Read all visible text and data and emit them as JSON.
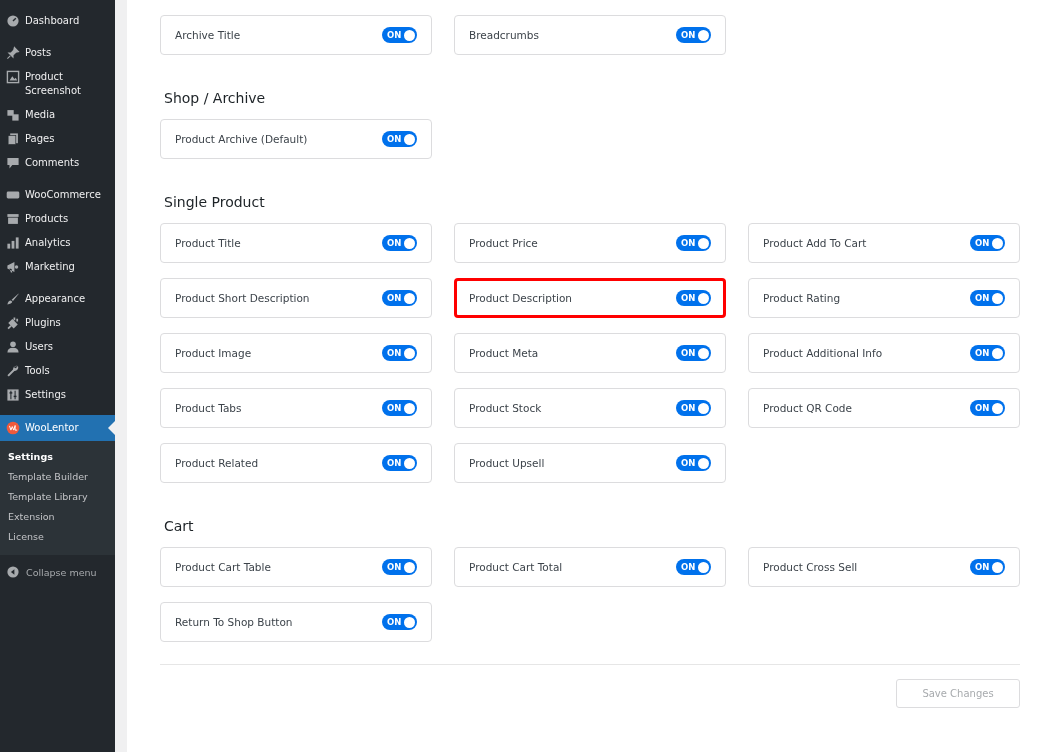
{
  "sidebar": {
    "groups": [
      [
        {
          "label": "Dashboard",
          "kind": "dashboard",
          "selected": false
        }
      ],
      [
        {
          "label": "Posts",
          "kind": "pin",
          "selected": false
        },
        {
          "label": "Product Screenshot",
          "kind": "image",
          "selected": false
        },
        {
          "label": "Media",
          "kind": "media",
          "selected": false
        },
        {
          "label": "Pages",
          "kind": "pages",
          "selected": false
        },
        {
          "label": "Comments",
          "kind": "comment",
          "selected": false
        }
      ],
      [
        {
          "label": "WooCommerce",
          "kind": "woo",
          "selected": false
        },
        {
          "label": "Products",
          "kind": "box",
          "selected": false
        },
        {
          "label": "Analytics",
          "kind": "bars",
          "selected": false
        },
        {
          "label": "Marketing",
          "kind": "megaphone",
          "selected": false
        }
      ],
      [
        {
          "label": "Appearance",
          "kind": "brush",
          "selected": false
        },
        {
          "label": "Plugins",
          "kind": "plug",
          "selected": false
        },
        {
          "label": "Users",
          "kind": "user",
          "selected": false
        },
        {
          "label": "Tools",
          "kind": "wrench",
          "selected": false
        },
        {
          "label": "Settings",
          "kind": "sliders",
          "selected": false
        }
      ],
      [
        {
          "label": "WooLentor",
          "kind": "wl",
          "selected": true
        }
      ]
    ],
    "submenu": [
      {
        "label": "Settings",
        "selected": true
      },
      {
        "label": "Template Builder",
        "selected": false
      },
      {
        "label": "Template Library",
        "selected": false
      },
      {
        "label": "Extension",
        "selected": false
      },
      {
        "label": "License",
        "selected": false
      }
    ],
    "collapse": "Collapse menu"
  },
  "sections": [
    {
      "items": [
        {
          "label": "Archive Title",
          "on": true,
          "toggle_text": "ON",
          "highlighted": false
        },
        {
          "label": "Breadcrumbs",
          "on": true,
          "toggle_text": "ON",
          "highlighted": false
        }
      ]
    },
    {
      "heading": "Shop / Archive",
      "items": [
        {
          "label": "Product Archive (Default)",
          "on": true,
          "toggle_text": "ON",
          "highlighted": false
        }
      ]
    },
    {
      "heading": "Single Product",
      "items": [
        {
          "label": "Product Title",
          "on": true,
          "toggle_text": "ON",
          "highlighted": false
        },
        {
          "label": "Product Price",
          "on": true,
          "toggle_text": "ON",
          "highlighted": false
        },
        {
          "label": "Product Add To Cart",
          "on": true,
          "toggle_text": "ON",
          "highlighted": false
        },
        {
          "label": "Product Short Description",
          "on": true,
          "toggle_text": "ON",
          "highlighted": false
        },
        {
          "label": "Product Description",
          "on": true,
          "toggle_text": "ON",
          "highlighted": true
        },
        {
          "label": "Product Rating",
          "on": true,
          "toggle_text": "ON",
          "highlighted": false
        },
        {
          "label": "Product Image",
          "on": true,
          "toggle_text": "ON",
          "highlighted": false
        },
        {
          "label": "Product Meta",
          "on": true,
          "toggle_text": "ON",
          "highlighted": false
        },
        {
          "label": "Product Additional Info",
          "on": true,
          "toggle_text": "ON",
          "highlighted": false
        },
        {
          "label": "Product Tabs",
          "on": true,
          "toggle_text": "ON",
          "highlighted": false
        },
        {
          "label": "Product Stock",
          "on": true,
          "toggle_text": "ON",
          "highlighted": false
        },
        {
          "label": "Product QR Code",
          "on": true,
          "toggle_text": "ON",
          "highlighted": false
        },
        {
          "label": "Product Related",
          "on": true,
          "toggle_text": "ON",
          "highlighted": false
        },
        {
          "label": "Product Upsell",
          "on": true,
          "toggle_text": "ON",
          "highlighted": false
        }
      ]
    },
    {
      "heading": "Cart",
      "items": [
        {
          "label": "Product Cart Table",
          "on": true,
          "toggle_text": "ON",
          "highlighted": false
        },
        {
          "label": "Product Cart Total",
          "on": true,
          "toggle_text": "ON",
          "highlighted": false
        },
        {
          "label": "Product Cross Sell",
          "on": true,
          "toggle_text": "ON",
          "highlighted": false
        },
        {
          "label": "Return To Shop Button",
          "on": true,
          "toggle_text": "ON",
          "highlighted": false
        }
      ]
    }
  ],
  "save_button": "Save Changes"
}
